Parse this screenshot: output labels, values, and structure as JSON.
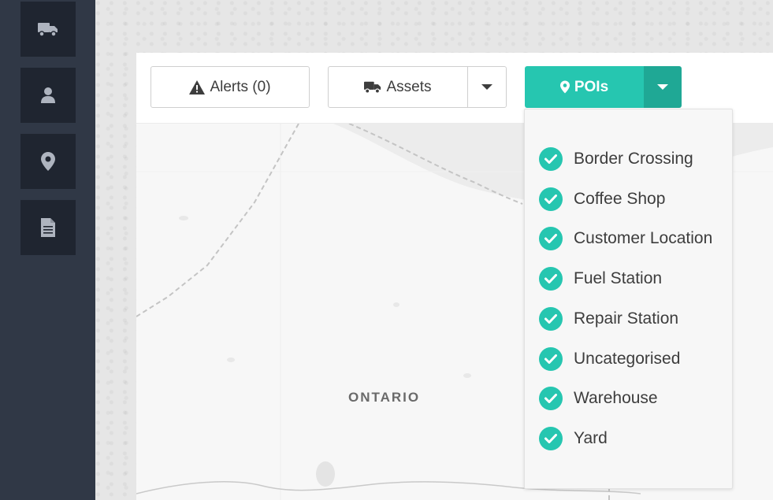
{
  "sidebar": {
    "items": [
      {
        "icon": "truck-icon"
      },
      {
        "icon": "user-icon"
      },
      {
        "icon": "map-marker-icon"
      },
      {
        "icon": "document-icon"
      }
    ]
  },
  "toolbar": {
    "alerts_label": "Alerts (0)",
    "assets_label": "Assets",
    "pois_label": "POIs"
  },
  "map": {
    "region_label": "ONTARIO"
  },
  "poi_dropdown": {
    "items": [
      {
        "label": "Border Crossing",
        "checked": true
      },
      {
        "label": "Coffee Shop",
        "checked": true
      },
      {
        "label": "Customer Location",
        "checked": true
      },
      {
        "label": "Fuel Station",
        "checked": true
      },
      {
        "label": "Repair Station",
        "checked": true
      },
      {
        "label": "Uncategorised",
        "checked": true
      },
      {
        "label": "Warehouse",
        "checked": true
      },
      {
        "label": "Yard",
        "checked": true
      }
    ]
  },
  "colors": {
    "accent": "#26c6b0",
    "accent_dark": "#1fa895",
    "sidebar_bg": "#303846",
    "sidebar_button_bg": "#1f2530"
  }
}
